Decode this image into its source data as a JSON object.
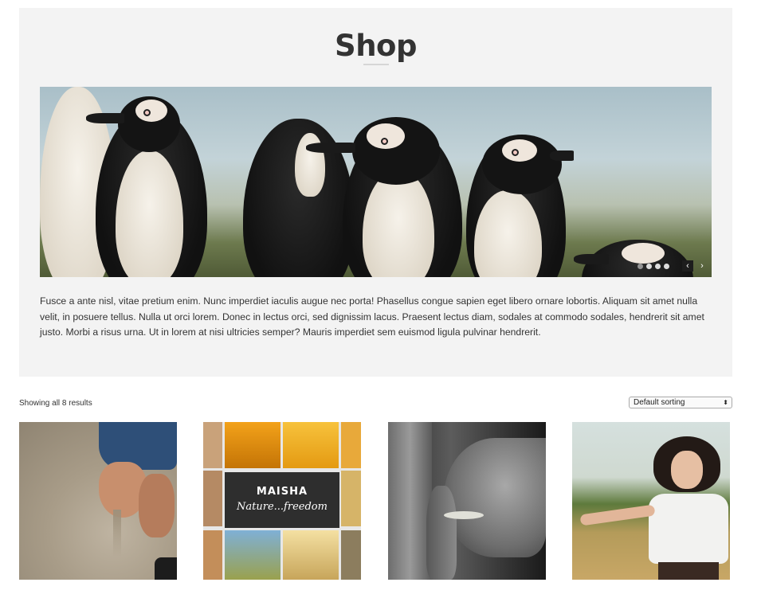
{
  "page": {
    "title": "Shop"
  },
  "slider": {
    "dots_count": 4,
    "active_dot": 0,
    "prev_icon": "chevron-left-icon",
    "next_icon": "chevron-right-icon",
    "prev_glyph": "‹",
    "next_glyph": "›"
  },
  "description": "Fusce a ante nisl, vitae pretium enim. Nunc imperdiet iaculis augue nec porta! Phasellus congue sapien eget libero ornare lobortis. Aliquam sit amet nulla velit, in posuere tellus. Nulla ut orci lorem. Donec in lectus orci, sed dignissim lacus. Praesent lectus diam, sodales at commodo sodales, hendrerit sit amet justo. Morbi a risus urna. Ut in lorem at nisi ultricies semper? Mauris imperdiet sem euismod ligula pulvinar hendrerit.",
  "toolbar": {
    "results_text": "Showing all 8 results",
    "sorting_selected": "Default sorting",
    "sorting_caret": "⬍"
  },
  "products": [
    {
      "image": "hands-sand-photo",
      "title": ""
    },
    {
      "image": "maisha-collage",
      "title": "",
      "card_name": "MAISHA",
      "card_tagline": "Nature...freedom"
    },
    {
      "image": "elephant-photo",
      "title": ""
    },
    {
      "image": "girl-field-photo",
      "title": ""
    }
  ]
}
